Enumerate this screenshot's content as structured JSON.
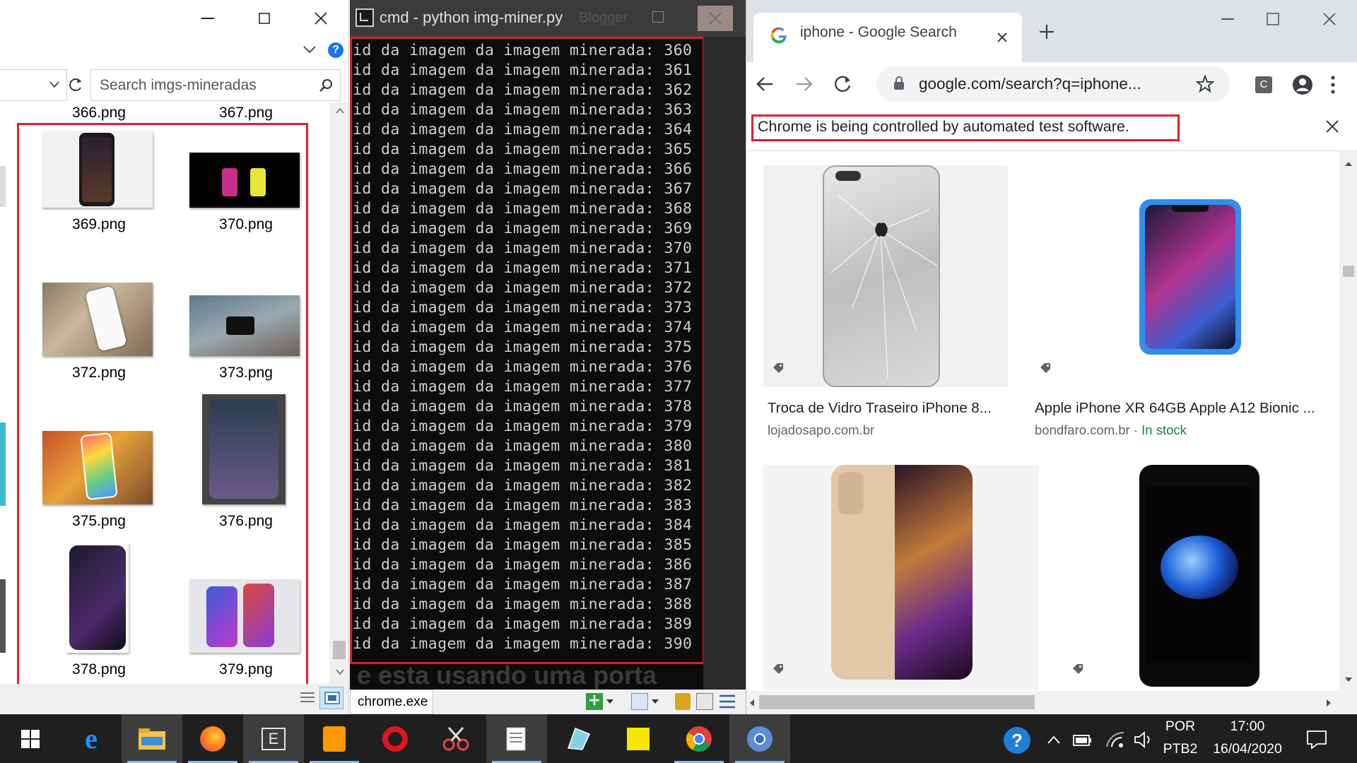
{
  "explorer": {
    "search_placeholder": "Search imgs-mineradas",
    "files": [
      {
        "name": "366.png"
      },
      {
        "name": "367.png"
      },
      {
        "name": "369.png"
      },
      {
        "name": "370.png"
      },
      {
        "name": "372.png"
      },
      {
        "name": "373.png"
      },
      {
        "name": "375.png"
      },
      {
        "name": "376.png"
      },
      {
        "name": "378.png"
      },
      {
        "name": "379.png"
      }
    ],
    "help_icon": "question-icon"
  },
  "cmd": {
    "title": "cmd - python  img-miner.py",
    "ghost_title": "Blogger",
    "lines": [
      "id da imagem da imagem minerada: 360",
      "id da imagem da imagem minerada: 361",
      "id da imagem da imagem minerada: 362",
      "id da imagem da imagem minerada: 363",
      "id da imagem da imagem minerada: 364",
      "id da imagem da imagem minerada: 365",
      "id da imagem da imagem minerada: 366",
      "id da imagem da imagem minerada: 367",
      "id da imagem da imagem minerada: 368",
      "id da imagem da imagem minerada: 369",
      "id da imagem da imagem minerada: 370",
      "id da imagem da imagem minerada: 371",
      "id da imagem da imagem minerada: 372",
      "id da imagem da imagem minerada: 373",
      "id da imagem da imagem minerada: 374",
      "id da imagem da imagem minerada: 375",
      "id da imagem da imagem minerada: 376",
      "id da imagem da imagem minerada: 377",
      "id da imagem da imagem minerada: 378",
      "id da imagem da imagem minerada: 379",
      "id da imagem da imagem minerada: 380",
      "id da imagem da imagem minerada: 381",
      "id da imagem da imagem minerada: 382",
      "id da imagem da imagem minerada: 383",
      "id da imagem da imagem minerada: 384",
      "id da imagem da imagem minerada: 385",
      "id da imagem da imagem minerada: 386",
      "id da imagem da imagem minerada: 387",
      "id da imagem da imagem minerada: 388",
      "id da imagem da imagem minerada: 389",
      "id da imagem da imagem minerada: 390"
    ],
    "ghost_text": "e esta usando uma porta",
    "bottom_tab": "chrome.exe"
  },
  "chrome": {
    "tab_title": "iphone - Google Search",
    "url": "google.com/search?q=iphone...",
    "profile_letter": "C",
    "infobar": "Chrome is being controlled by automated test software.",
    "results": [
      {
        "title": "Troca de Vidro Traseiro iPhone 8...",
        "source": "lojadosapo.com.br",
        "stock": ""
      },
      {
        "title": "Apple iPhone XR 64GB Apple A12 Bionic ...",
        "source": "bondfaro.com.br · ",
        "stock": "In stock"
      }
    ]
  },
  "taskbar": {
    "lang_top": "POR",
    "lang_bottom": "PTB2",
    "time": "17:00",
    "date": "16/04/2020"
  },
  "colors": {
    "highlight_red": "#e01e2a",
    "taskbar_bg": "#1f1f1f",
    "cmd_bg": "#0c0c0c",
    "in_stock_green": "#188038"
  }
}
